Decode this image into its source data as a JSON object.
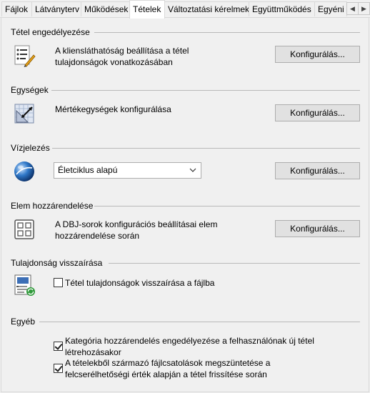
{
  "tabs": [
    {
      "label": "Fájlok"
    },
    {
      "label": "Látványterv"
    },
    {
      "label": "Működések"
    },
    {
      "label": "Tételek"
    },
    {
      "label": "Változtatási kérelmek"
    },
    {
      "label": "Együttműködés"
    },
    {
      "label": "Egyéni"
    }
  ],
  "active_tab": "Tételek",
  "sections": {
    "item_enable": {
      "title": "Tétel engedélyezése",
      "description": "A kliensláthatóság beállítása a tétel tulajdonságok vonatkozásában",
      "button": "Konfigurálás..."
    },
    "units": {
      "title": "Egységek",
      "description": "Mértékegységek konfigurálása",
      "button": "Konfigurálás..."
    },
    "watermark": {
      "title": "Vízjelezés",
      "dropdown_value": "Életciklus alapú",
      "button": "Konfigurálás..."
    },
    "element_assign": {
      "title": "Elem hozzárendelése",
      "description": "A DBJ-sorok konfigurációs beállításai elem hozzárendelése során",
      "button": "Konfigurálás..."
    },
    "property_writeback": {
      "title": "Tulajdonság visszaírása",
      "checkbox_label": "Tétel tulajdonságok visszaírása a fájlba",
      "checked": false
    },
    "other": {
      "title": "Egyéb",
      "options": [
        {
          "label": "Kategória hozzárendelés engedélyezése a felhasználónak új tétel létrehozásakor",
          "checked": true
        },
        {
          "label": "A tételekből származó fájlcsatolások megszüntetése a felcserélhetőségi érték alapján a tétel frissítése során",
          "checked": true
        }
      ]
    }
  },
  "icons": {
    "item_enable": "list-pencil-icon",
    "units": "ruler-grid-icon",
    "watermark": "globe-icon",
    "element_assign": "grid-icon",
    "property_writeback": "writeback-icon"
  }
}
